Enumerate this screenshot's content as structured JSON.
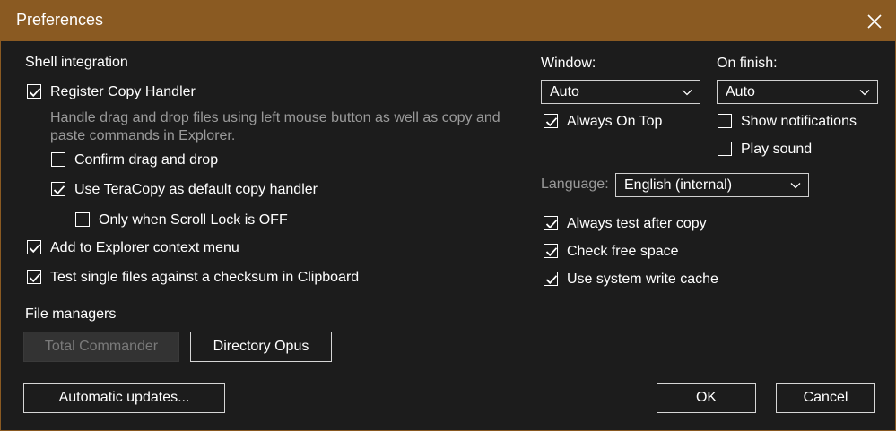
{
  "window": {
    "title": "Preferences"
  },
  "shell": {
    "heading": "Shell integration",
    "register_handler": {
      "label": "Register Copy Handler",
      "checked": true
    },
    "description": "Handle drag and drop files using left mouse button as well as copy and paste commands in Explorer.",
    "confirm_drag": {
      "label": "Confirm drag and drop",
      "checked": false
    },
    "default_handler": {
      "label": "Use TeraCopy as default copy handler",
      "checked": true
    },
    "scroll_lock": {
      "label": "Only when Scroll Lock is OFF",
      "checked": false
    },
    "context_menu": {
      "label": "Add to Explorer context menu",
      "checked": true
    },
    "checksum": {
      "label": "Test single files against a checksum in Clipboard",
      "checked": true
    }
  },
  "file_managers": {
    "heading": "File managers",
    "total_commander": "Total Commander",
    "directory_opus": "Directory Opus"
  },
  "window_opts": {
    "window_label": "Window:",
    "window_value": "Auto",
    "on_finish_label": "On finish:",
    "on_finish_value": "Auto",
    "always_on_top": {
      "label": "Always On Top",
      "checked": true
    },
    "show_notifications": {
      "label": "Show notifications",
      "checked": false
    },
    "play_sound": {
      "label": "Play sound",
      "checked": false
    },
    "language_label": "Language:",
    "language_value": "English (internal)"
  },
  "copy_opts": {
    "always_test": {
      "label": "Always test after copy",
      "checked": true
    },
    "free_space": {
      "label": "Check free space",
      "checked": true
    },
    "write_cache": {
      "label": "Use system write cache",
      "checked": true
    }
  },
  "footer": {
    "updates": "Automatic updates...",
    "ok": "OK",
    "cancel": "Cancel"
  },
  "colors": {
    "titlebar": "#8a5a22",
    "background": "#1c1c1c",
    "text": "#ffffff",
    "muted": "#9a9a9a"
  }
}
